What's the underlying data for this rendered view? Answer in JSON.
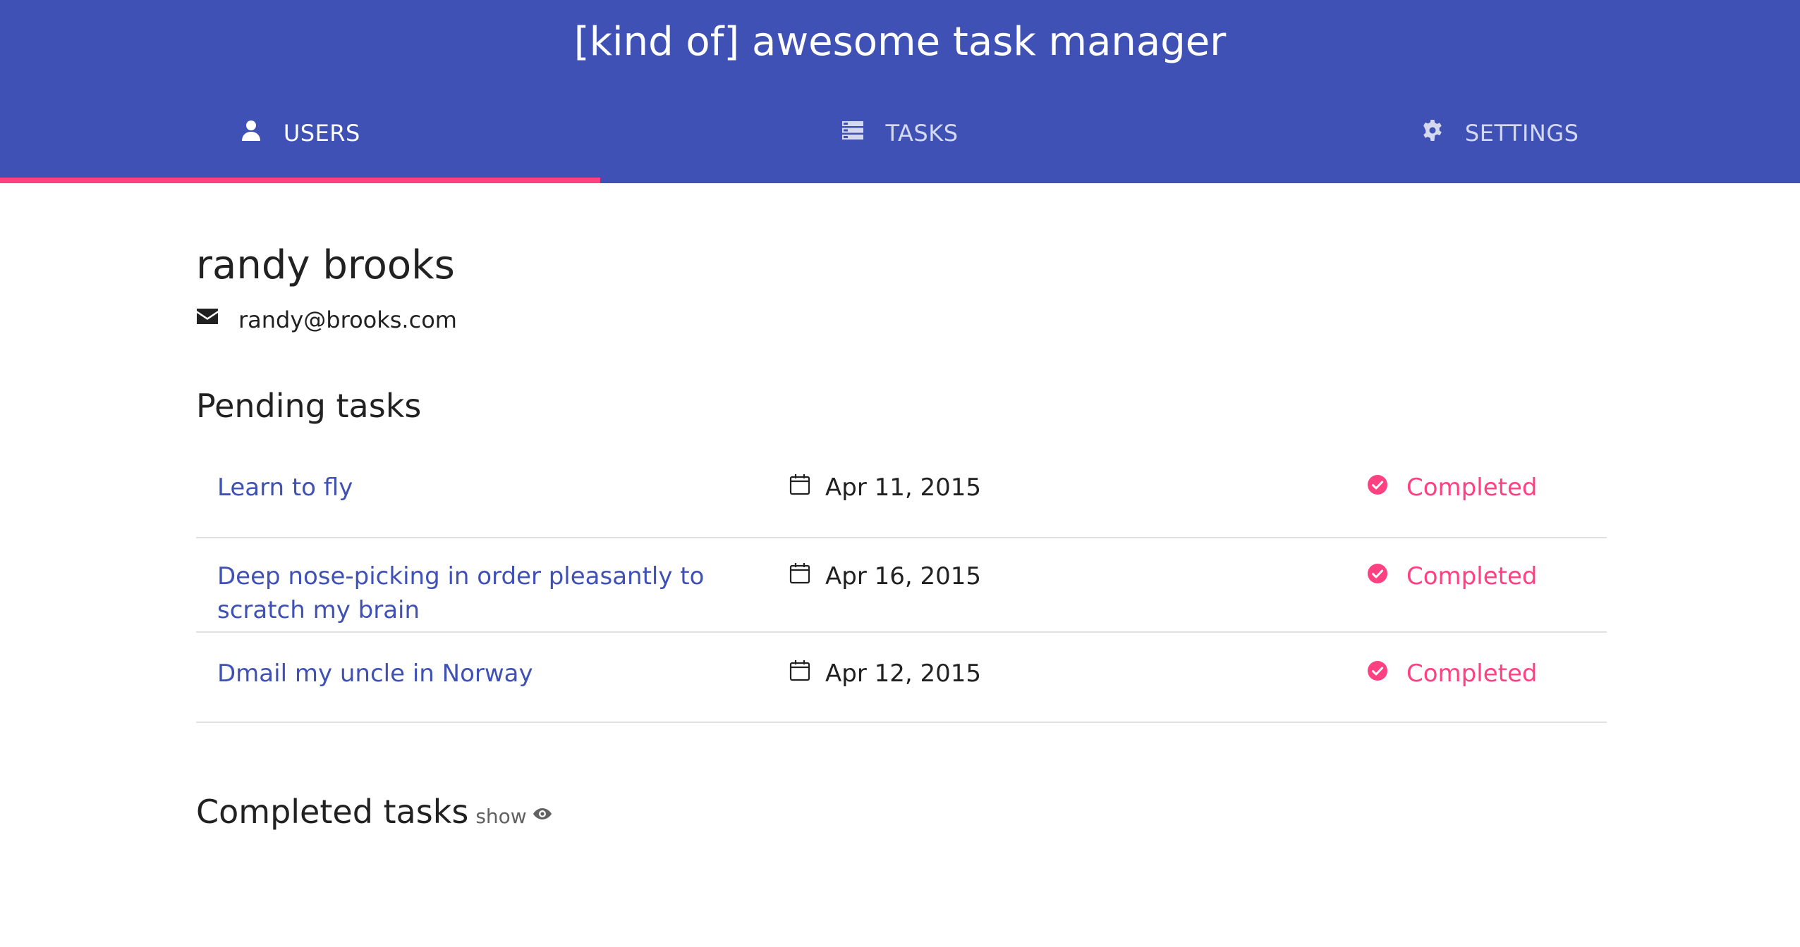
{
  "header": {
    "title": "[kind of] awesome task manager",
    "background_color": "#3f51b5",
    "indicator_color": "#ff4081"
  },
  "tabs": [
    {
      "label": "USERS",
      "icon": "user-icon",
      "active": true
    },
    {
      "label": "TASKS",
      "icon": "list-icon",
      "active": false
    },
    {
      "label": "SETTINGS",
      "icon": "gear-icon",
      "active": false
    }
  ],
  "user": {
    "name": "randy brooks",
    "email": "randy@brooks.com",
    "email_icon": "envelope-icon"
  },
  "pending": {
    "title": "Pending tasks",
    "tasks": [
      {
        "name": "Learn to fly",
        "date": "Apr 11, 2015",
        "status": "Completed"
      },
      {
        "name": "Deep nose-picking in order pleasantly to scratch my brain",
        "date": "Apr 16, 2015",
        "status": "Completed"
      },
      {
        "name": "Dmail my uncle in Norway",
        "date": "Apr 12, 2015",
        "status": "Completed"
      }
    ],
    "status_color": "#ff4081",
    "link_color": "#3f51b5"
  },
  "completed": {
    "title": "Completed tasks",
    "toggle_label": "show",
    "toggle_icon": "eye-icon"
  }
}
